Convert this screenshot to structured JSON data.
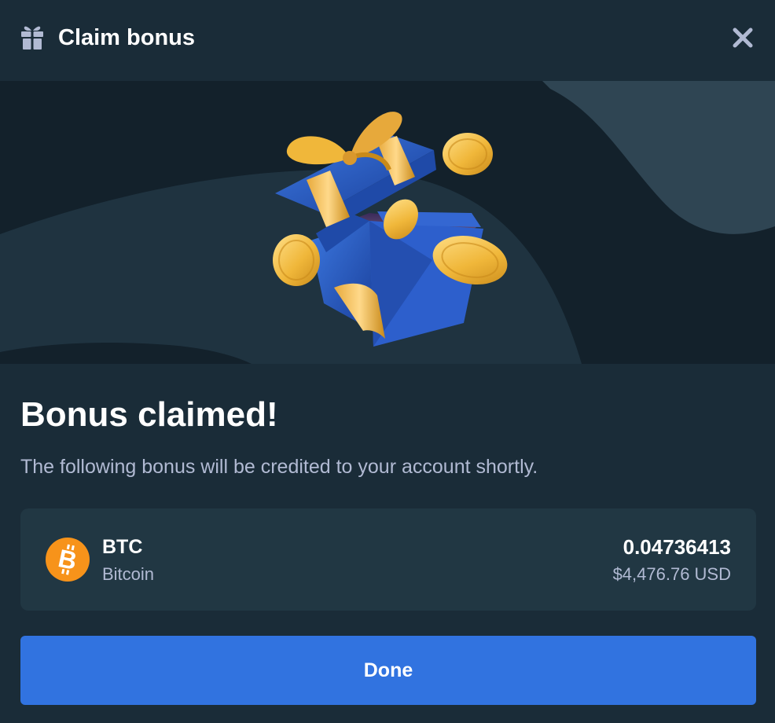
{
  "header": {
    "title": "Claim bonus",
    "icon": "gift-icon",
    "close_icon": "close-icon"
  },
  "hero": {
    "illustration": "open-gift-box-with-coins"
  },
  "content": {
    "heading": "Bonus claimed!",
    "description": "The following bonus will be credited to your account shortly."
  },
  "bonus": {
    "symbol": "BTC",
    "name": "Bitcoin",
    "amount": "0.04736413",
    "fiat_value": "$4,476.76 USD",
    "icon": "bitcoin-icon"
  },
  "actions": {
    "done_label": "Done"
  },
  "colors": {
    "background": "#1a2c38",
    "card": "#213743",
    "primary": "#3173e0",
    "muted_text": "#b1bad3",
    "bitcoin": "#f7931a"
  }
}
